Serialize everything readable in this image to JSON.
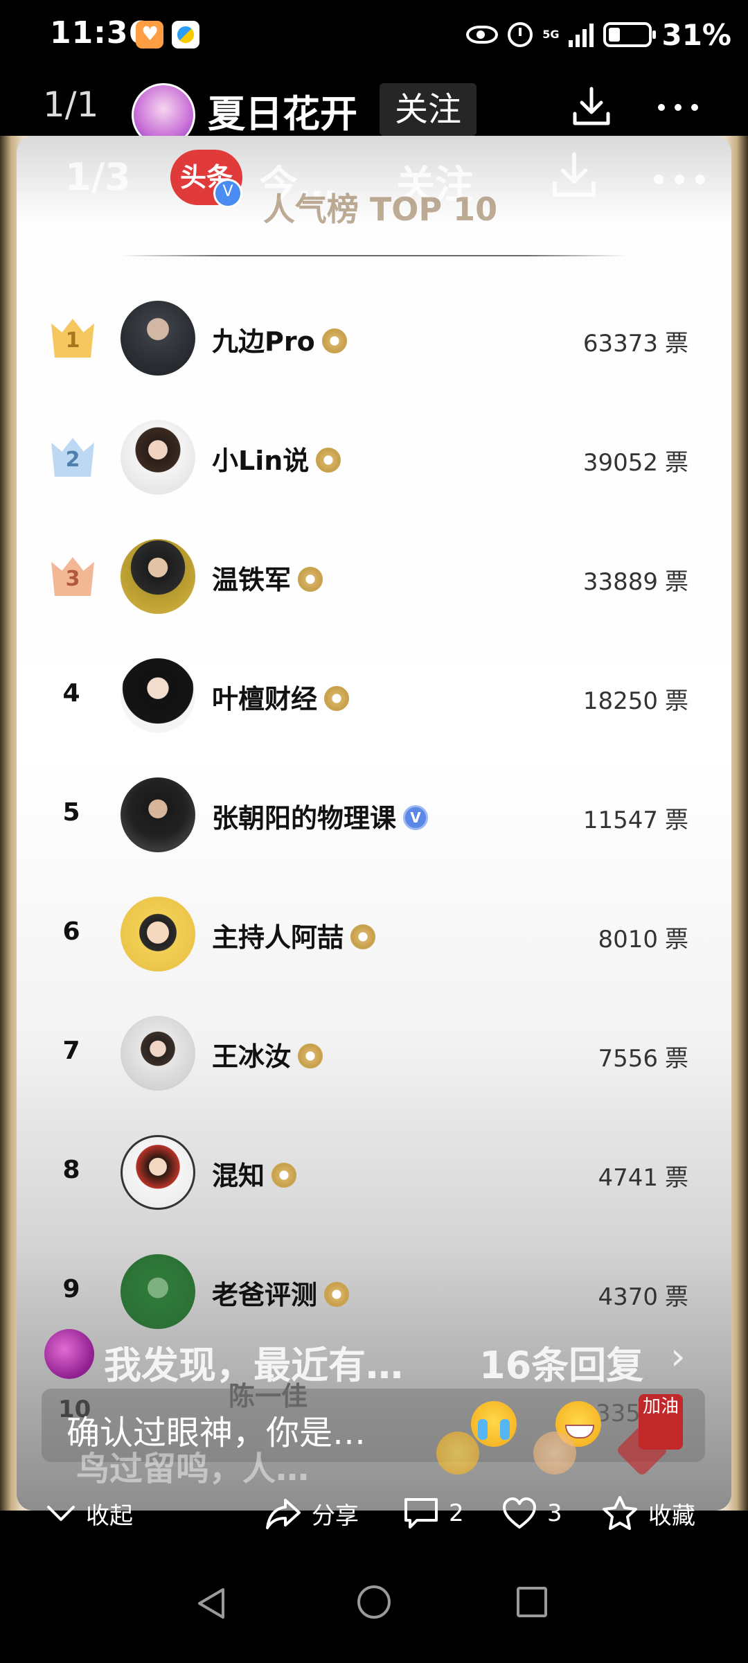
{
  "status_bar": {
    "time": "11:36",
    "network": "5G",
    "battery": "31%"
  },
  "top_bar": {
    "counter": "1/1",
    "username": "夏日花开",
    "follow_label": "关注"
  },
  "image_overlay": {
    "counter": "1/3",
    "logo_text": "头条",
    "source_name": "今…",
    "follow_label": "关注"
  },
  "board": {
    "title": "人气榜 TOP 10",
    "vote_unit": "票",
    "entries": [
      {
        "rank": "1",
        "name": "九边Pro",
        "votes": "63373",
        "verified": "gold"
      },
      {
        "rank": "2",
        "name": "小Lin说",
        "votes": "39052",
        "verified": "gold"
      },
      {
        "rank": "3",
        "name": "温铁军",
        "votes": "33889",
        "verified": "gold"
      },
      {
        "rank": "4",
        "name": "叶檀财经",
        "votes": "18250",
        "verified": "gold"
      },
      {
        "rank": "5",
        "name": "张朝阳的物理课",
        "votes": "11547",
        "verified": "blue"
      },
      {
        "rank": "6",
        "name": "主持人阿喆",
        "votes": "8010",
        "verified": "gold"
      },
      {
        "rank": "7",
        "name": "王冰汝",
        "votes": "7556",
        "verified": "gold"
      },
      {
        "rank": "8",
        "name": "混知",
        "votes": "4741",
        "verified": "gold"
      },
      {
        "rank": "9",
        "name": "老爸评测",
        "votes": "4370",
        "verified": "gold"
      }
    ],
    "partial_entry": {
      "rank": "10",
      "name": "陈一佳",
      "votes": "335…"
    }
  },
  "comments": {
    "preview_text": "我发现，最近有…",
    "replies": "16条回复",
    "input_text": "确认过眼神，你是…",
    "second_line": "鸟过留鸣，人…",
    "oil_badge": "加油"
  },
  "actions": {
    "collapse": "收起",
    "share": "分享",
    "comments_count": "2",
    "likes_count": "3",
    "favorite": "收藏"
  },
  "colors": {
    "gold_crown": "#f4c85e",
    "silver_crown": "#bcd8f2",
    "bronze_crown": "#f2b896",
    "title_color": "#8a6a42",
    "verified_blue": "#5b87e6"
  },
  "icons": [
    "download-icon",
    "more-icon",
    "chevron-down-icon",
    "share-icon",
    "comment-icon",
    "heart-icon",
    "star-icon",
    "back-icon",
    "home-icon",
    "recent-apps-icon"
  ]
}
